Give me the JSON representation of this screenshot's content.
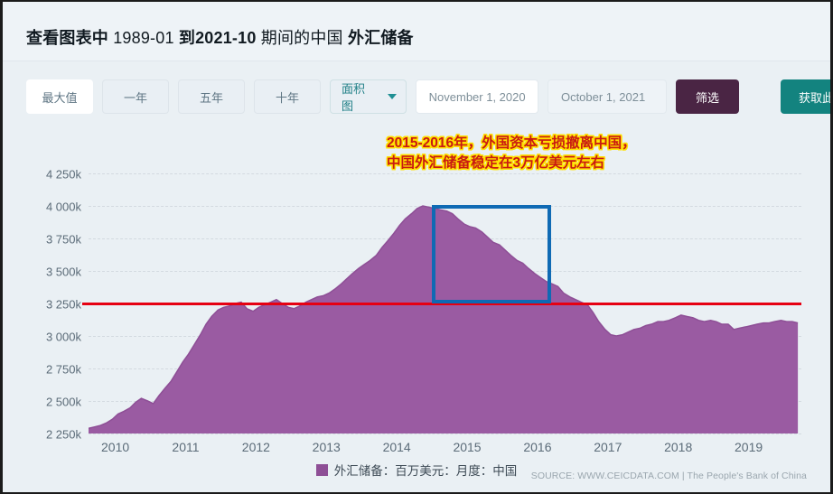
{
  "header": {
    "title_bold_1": "查看图表中",
    "title_normal_1": " 1989-01 ",
    "title_bold_2": "到2021-10",
    "title_normal_2": " 期间的中国 ",
    "title_bold_3": "外汇储备"
  },
  "toolbar": {
    "range_max_label": "最大值",
    "range_1y_label": "一年",
    "range_5y_label": "五年",
    "range_10y_label": "十年",
    "chart_type_label": "面积图",
    "chart_type_icon": "chevron-down-icon",
    "date_from_value": "November 1, 2020",
    "date_to_value": "October 1, 2021",
    "filter_label": "筛选",
    "get_data_label": "获取此数据"
  },
  "annotation": {
    "line1": "2015-2016年，外国资本亏损撤离中国，",
    "line2": "中国外汇储备稳定在3万亿美元左右",
    "text_color": "#c91a12",
    "outline_color": "#ffe000"
  },
  "legend": {
    "series_label": "外汇储备：百万美元：月度：中国",
    "swatch_color": "#8e4f96"
  },
  "footer": {
    "source": "SOURCE: WWW.CEICDATA.COM | The People's Bank of China"
  },
  "chart_data": {
    "type": "area",
    "title": "",
    "xlabel": "",
    "ylabel": "",
    "grid": true,
    "legend_position": "bottom",
    "series_name": "外汇储备：百万美元：月度：中国",
    "series_color": "#9a5ba2",
    "ylim": [
      2250,
      4375
    ],
    "ytick_labels": [
      "4 250k",
      "4 000k",
      "3 750k",
      "3 500k",
      "3 250k",
      "3 000k",
      "2 750k",
      "2 500k",
      "2 250k"
    ],
    "ytick_values": [
      4250,
      4000,
      3750,
      3500,
      3250,
      3000,
      2750,
      2500,
      2250
    ],
    "xtick_labels": [
      "2010",
      "2011",
      "2012",
      "2013",
      "2014",
      "2015",
      "2016",
      "2017",
      "2018",
      "2019"
    ],
    "xtick_values": [
      2010,
      2011,
      2012,
      2013,
      2014,
      2015,
      2016,
      2017,
      2018,
      2019
    ],
    "xlim": [
      2009.62,
      2019.75
    ],
    "reference_line": {
      "value": 3250,
      "color": "#e60012",
      "label": ""
    },
    "highlight_region": {
      "x_start": 2014.5,
      "x_end": 2016.2,
      "y_top": 4010,
      "y_bottom": 3250,
      "color": "#0f6ab4"
    },
    "x": [
      2009.62,
      2009.7,
      2009.79,
      2009.87,
      2009.96,
      2010.04,
      2010.12,
      2010.21,
      2010.29,
      2010.37,
      2010.46,
      2010.54,
      2010.62,
      2010.71,
      2010.79,
      2010.87,
      2010.96,
      2011.04,
      2011.12,
      2011.21,
      2011.29,
      2011.37,
      2011.46,
      2011.54,
      2011.62,
      2011.71,
      2011.79,
      2011.87,
      2011.96,
      2012.04,
      2012.12,
      2012.21,
      2012.29,
      2012.37,
      2012.46,
      2012.54,
      2012.62,
      2012.71,
      2012.79,
      2012.87,
      2012.96,
      2013.04,
      2013.12,
      2013.21,
      2013.29,
      2013.37,
      2013.46,
      2013.54,
      2013.62,
      2013.71,
      2013.79,
      2013.87,
      2013.96,
      2014.04,
      2014.12,
      2014.21,
      2014.29,
      2014.37,
      2014.46,
      2014.54,
      2014.62,
      2014.71,
      2014.79,
      2014.87,
      2014.96,
      2015.04,
      2015.12,
      2015.21,
      2015.29,
      2015.37,
      2015.46,
      2015.54,
      2015.62,
      2015.71,
      2015.79,
      2015.87,
      2015.96,
      2016.04,
      2016.12,
      2016.21,
      2016.29,
      2016.37,
      2016.46,
      2016.54,
      2016.62,
      2016.71,
      2016.79,
      2016.87,
      2016.96,
      2017.04,
      2017.12,
      2017.21,
      2017.29,
      2017.37,
      2017.46,
      2017.54,
      2017.62,
      2017.71,
      2017.79,
      2017.87,
      2017.96,
      2018.04,
      2018.12,
      2018.21,
      2018.29,
      2018.37,
      2018.46,
      2018.54,
      2018.62,
      2018.71,
      2018.79,
      2018.87,
      2018.96,
      2019.04,
      2019.12,
      2019.21,
      2019.29,
      2019.37,
      2019.46,
      2019.54,
      2019.62,
      2019.7
    ],
    "values": [
      2290,
      2300,
      2312,
      2330,
      2360,
      2400,
      2420,
      2447,
      2490,
      2520,
      2500,
      2480,
      2540,
      2600,
      2650,
      2720,
      2800,
      2860,
      2930,
      3010,
      3090,
      3150,
      3200,
      3220,
      3230,
      3250,
      3260,
      3210,
      3190,
      3220,
      3240,
      3260,
      3280,
      3250,
      3220,
      3210,
      3230,
      3260,
      3280,
      3300,
      3310,
      3330,
      3360,
      3400,
      3440,
      3480,
      3520,
      3550,
      3580,
      3620,
      3680,
      3730,
      3790,
      3850,
      3900,
      3940,
      3980,
      4000,
      3990,
      3980,
      3970,
      3960,
      3940,
      3900,
      3860,
      3840,
      3830,
      3800,
      3760,
      3720,
      3700,
      3660,
      3620,
      3580,
      3560,
      3520,
      3480,
      3450,
      3420,
      3400,
      3380,
      3330,
      3300,
      3280,
      3260,
      3240,
      3180,
      3110,
      3050,
      3010,
      3000,
      3010,
      3030,
      3050,
      3060,
      3080,
      3090,
      3110,
      3110,
      3120,
      3140,
      3160,
      3150,
      3140,
      3120,
      3110,
      3120,
      3110,
      3090,
      3090,
      3050,
      3060,
      3070,
      3080,
      3090,
      3100,
      3100,
      3110,
      3120,
      3110,
      3110,
      3100
    ]
  }
}
